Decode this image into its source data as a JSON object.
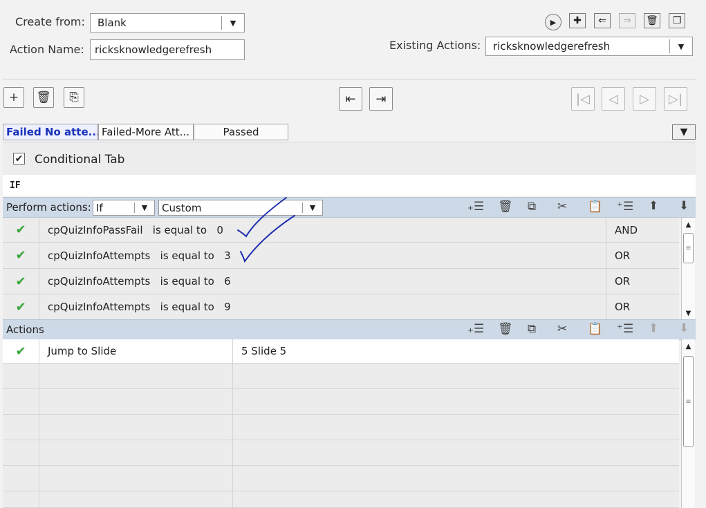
{
  "header": {
    "create_from_label": "Create from:",
    "create_from_value": "Blank",
    "action_name_label": "Action Name:",
    "action_name_value": "ricksknowledgerefresh",
    "existing_actions_label": "Existing Actions:",
    "existing_actions_value": "ricksknowledgerefresh"
  },
  "tabs": [
    {
      "label": "Failed No atte..."
    },
    {
      "label": "Failed-More Att..."
    },
    {
      "label": "Passed"
    }
  ],
  "conditional_tab": {
    "label": "Conditional Tab",
    "checked": true
  },
  "if_label": "IF",
  "perform": {
    "label": "Perform actions:",
    "mode": "If",
    "type": "Custom"
  },
  "conditions": [
    {
      "variable": "cpQuizInfoPassFail",
      "operator": "is equal to",
      "value": "0",
      "logic": "AND"
    },
    {
      "variable": "cpQuizInfoAttempts",
      "operator": "is equal to",
      "value": "3",
      "logic": "OR"
    },
    {
      "variable": "cpQuizInfoAttempts",
      "operator": "is equal to",
      "value": "6",
      "logic": "OR"
    },
    {
      "variable": "cpQuizInfoAttempts",
      "operator": "is equal to",
      "value": "9",
      "logic": "OR"
    }
  ],
  "actions_label": "Actions",
  "actions": [
    {
      "action": "Jump to Slide",
      "target": "5 Slide 5"
    },
    {
      "action": "",
      "target": ""
    },
    {
      "action": "",
      "target": ""
    },
    {
      "action": "",
      "target": ""
    },
    {
      "action": "",
      "target": ""
    },
    {
      "action": "",
      "target": ""
    }
  ],
  "icons": {
    "check": "✔",
    "annotation_color": "#1f2fb0",
    "check_color": "#3aa53a"
  }
}
